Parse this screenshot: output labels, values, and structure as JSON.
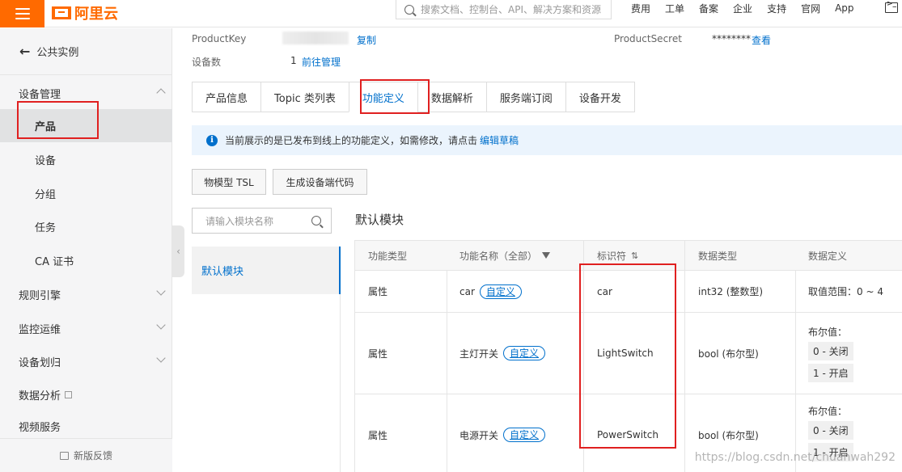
{
  "topbar": {
    "logo_text": "阿里云",
    "search_placeholder": "搜索文档、控制台、API、解决方案和资源",
    "links": [
      "费用",
      "工单",
      "备案",
      "企业",
      "支持",
      "官网",
      "App"
    ]
  },
  "sidebar": {
    "back_label": "公共实例",
    "groups": {
      "device_mgmt": "设备管理",
      "rules": "规则引擎",
      "monitor": "监控运维",
      "assign": "设备划归",
      "analytics": "数据分析",
      "video": "视频服务"
    },
    "items": [
      "产品",
      "设备",
      "分组",
      "任务",
      "CA 证书"
    ],
    "feedback": "新版反馈"
  },
  "product_info": {
    "key_label": "ProductKey",
    "copy_link": "复制",
    "secret_label": "ProductSecret",
    "secret_value": "********",
    "view_link": "查看",
    "device_count_label": "设备数",
    "device_count": "1",
    "manage_link": "前往管理"
  },
  "tabs": [
    "产品信息",
    "Topic 类列表",
    "功能定义",
    "数据解析",
    "服务端订阅",
    "设备开发"
  ],
  "notice": {
    "text": "当前展示的是已发布到线上的功能定义，如需修改，请点击",
    "link": "编辑草稿"
  },
  "buttons": {
    "tsl": "物模型 TSL",
    "gen_code": "生成设备端代码"
  },
  "module": {
    "search_placeholder": "请输入模块名称",
    "selected": "默认模块",
    "title": "默认模块"
  },
  "table": {
    "headers": [
      "功能类型",
      "功能名称（全部）",
      "标识符",
      "数据类型",
      "数据定义"
    ],
    "rows": [
      {
        "type": "属性",
        "name": "car",
        "tag": "自定义",
        "id": "car",
        "dtype": "int32 (整数型)",
        "def_label": "取值范围：0 ~ 4",
        "chips": []
      },
      {
        "type": "属性",
        "name": "主灯开关",
        "tag": "自定义",
        "id": "LightSwitch",
        "dtype": "bool (布尔型)",
        "def_label": "布尔值：",
        "chips": [
          "0 - 关闭",
          "1 - 开启"
        ]
      },
      {
        "type": "属性",
        "name": "电源开关",
        "tag": "自定义",
        "id": "PowerSwitch",
        "dtype": "bool (布尔型)",
        "def_label": "布尔值：",
        "chips": [
          "0 - 关闭",
          "1 - 开启"
        ]
      }
    ]
  },
  "watermark": "https://blog.csdn.net/chuanwah292"
}
